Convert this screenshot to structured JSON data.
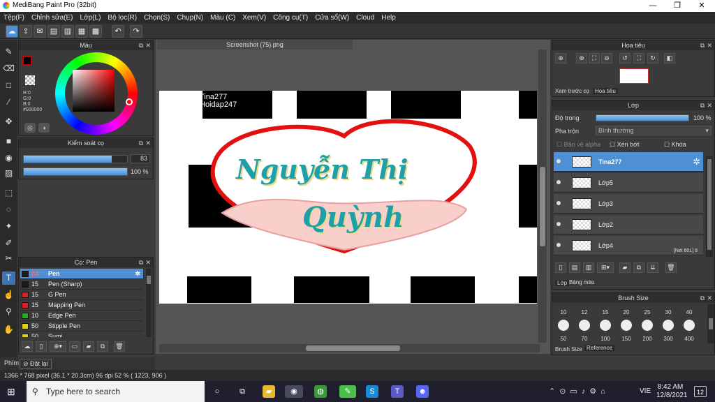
{
  "window": {
    "title": "MediBang Paint Pro (32bit)",
    "minimize": "—",
    "maximize": "❐",
    "close": "✕"
  },
  "menu": [
    "Tệp(F)",
    "Chỉnh sửa(E)",
    "Lớp(L)",
    "Bộ lọc(R)",
    "Chọn(S)",
    "Chụp(N)",
    "Màu (C)",
    "Xem(V)",
    "Công cụ(T)",
    "Cửa sổ(W)",
    "Cloud",
    "Help"
  ],
  "color_panel": {
    "title": "Màu",
    "r": "R:0",
    "g": "G:0",
    "b": "B:0",
    "hex": "#000000"
  },
  "brush_control": {
    "title": "Kiểm soát cọ",
    "size_value": "83",
    "opacity_value": "100 %",
    "size_fraction": 0.85,
    "opacity_fraction": 1.0
  },
  "brush_panel": {
    "title": "Cọ: Pen",
    "brushes": [
      {
        "size": "83",
        "name": "Pen",
        "color": "#1a1a1a",
        "selected": true
      },
      {
        "size": "15",
        "name": "Pen (Sharp)",
        "color": "#1a1a1a"
      },
      {
        "size": "15",
        "name": "G Pen",
        "color": "#e02020"
      },
      {
        "size": "15",
        "name": "Mapping Pen",
        "color": "#e02020"
      },
      {
        "size": "10",
        "name": "Edge Pen",
        "color": "#20b020"
      },
      {
        "size": "50",
        "name": "Stipple Pen",
        "color": "#e0d020"
      },
      {
        "size": "50",
        "name": "Sumi",
        "color": "#e0d020"
      }
    ]
  },
  "document": {
    "tab": "Screenshot (75).png",
    "watermark_line1": "Tina277",
    "watermark_line2": "Hoidap247",
    "text_line1": "Nguyễn Thị",
    "text_line2": "Quỳnh"
  },
  "navigator": {
    "title": "Hoa tiêu",
    "tab1": "Xem trước cọ",
    "tab2": "Hoa tiêu"
  },
  "layer_panel": {
    "title": "Lớp",
    "opacity_label": "Độ trong",
    "opacity_value": "100 %",
    "blend_label": "Pha trộn",
    "blend_value": "Bình thường",
    "protect_alpha": "Bảo vệ alpha",
    "clipping": "Xén bớt",
    "lock": "Khóa",
    "layers": [
      {
        "name": "Tina277",
        "selected": true
      },
      {
        "name": "Lớp5"
      },
      {
        "name": "Lớp3"
      },
      {
        "name": "Lớp2"
      },
      {
        "name": "Lớp4",
        "extra": "[Net 60L]  8"
      }
    ],
    "tab1": "Lớp",
    "tab2": "Bảng màu"
  },
  "brush_size_panel": {
    "title": "Brush Size",
    "row1": [
      "10",
      "12",
      "15",
      "20",
      "25",
      "30",
      "40"
    ],
    "row2": [
      "50",
      "70",
      "100",
      "150",
      "200",
      "300",
      "400"
    ],
    "tab1": "Brush Size",
    "tab2": "Reference"
  },
  "bottom_left": {
    "tab": "Phím",
    "reset": "Đặt lại"
  },
  "status": {
    "text": "1366 * 768 pixel   (36.1 * 20.3cm)   96 dpi   52 %   ( 1223, 906 )"
  },
  "taskbar": {
    "search_placeholder": "Type here to search",
    "lang": "VIE",
    "time": "8:42 AM",
    "date": "12/8/2021",
    "notif": "12"
  }
}
